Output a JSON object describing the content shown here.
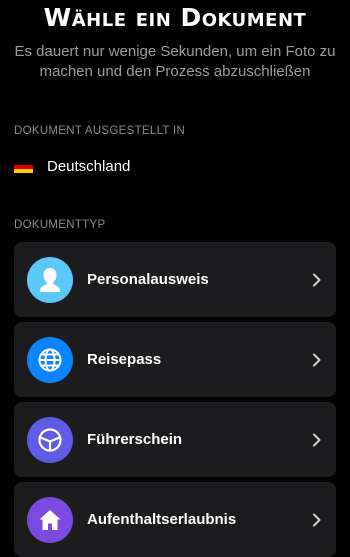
{
  "header": {
    "title": "Wähle ein Dokument",
    "subtitle": "Es dauert nur wenige Sekunden, um ein Foto zu machen und den Prozess abzuschließen"
  },
  "issuer": {
    "section_label": "Dokument ausgestellt in",
    "country": "Deutschland",
    "flag_colors": [
      "#000000",
      "#dd0000",
      "#ffce00"
    ]
  },
  "document_type": {
    "section_label": "Dokumenttyp",
    "items": [
      {
        "label": "Personalausweis",
        "icon": "person-icon",
        "color": "#5ac8fa"
      },
      {
        "label": "Reisepass",
        "icon": "globe-icon",
        "color": "#0a84ff"
      },
      {
        "label": "Führerschein",
        "icon": "steering-wheel-icon",
        "color": "#5e5ce6"
      },
      {
        "label": "Aufenthaltserlaubnis",
        "icon": "home-icon",
        "color": "#7b4ae0"
      }
    ]
  }
}
